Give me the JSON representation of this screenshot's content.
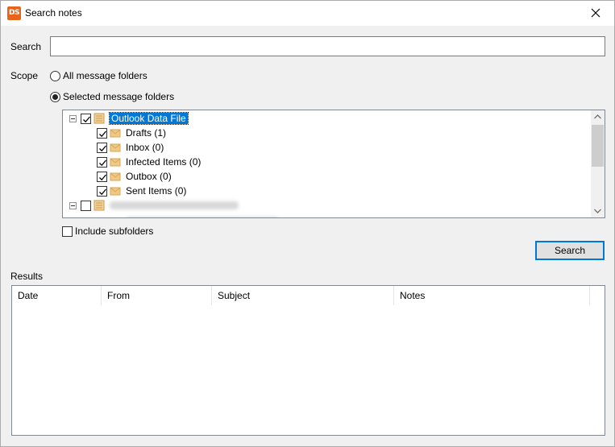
{
  "window": {
    "title": "Search notes",
    "app_icon": "DS"
  },
  "search": {
    "label": "Search",
    "value": "",
    "placeholder": ""
  },
  "scope": {
    "label": "Scope",
    "options": [
      {
        "label": "All message folders",
        "selected": false
      },
      {
        "label": "Selected message folders",
        "selected": true
      }
    ]
  },
  "tree": {
    "root1": {
      "label": "Outlook Data File",
      "checked": true,
      "children": [
        {
          "label": "Drafts (1)",
          "checked": true
        },
        {
          "label": "Inbox (0)",
          "checked": true
        },
        {
          "label": "Infected Items (0)",
          "checked": true
        },
        {
          "label": "Outbox (0)",
          "checked": true
        },
        {
          "label": "Sent Items (0)",
          "checked": true
        }
      ]
    },
    "root2": {
      "checked": false
    }
  },
  "include_subfolders": {
    "label": "Include subfolders",
    "checked": false
  },
  "search_button": {
    "label": "Search"
  },
  "results": {
    "label": "Results",
    "columns": [
      "Date",
      "From",
      "Subject",
      "Notes"
    ]
  },
  "colors": {
    "accent": "#0078d7",
    "folder": "#e8b86a",
    "app_icon": "#e8641b"
  }
}
